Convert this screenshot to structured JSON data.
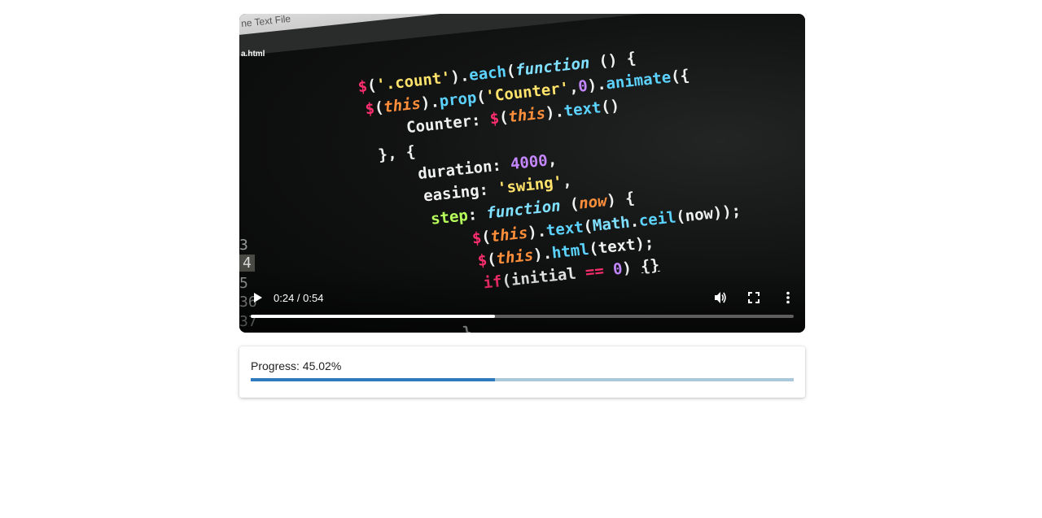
{
  "video": {
    "time_display": "0:24 / 0:54",
    "playback_fraction": 0.4502,
    "filename_tab": "a.html",
    "tab_text": "ne Text   File",
    "gutter_numbers": [
      "3",
      "4",
      "5",
      "36",
      "37"
    ],
    "code_lines": [
      "$('.count').each(function () {",
      "$(this).prop('Counter',0).animate({",
      "Counter: $(this).text()",
      "}, {",
      "duration: 4000,",
      "easing: 'swing',",
      "step: function (now) {",
      "$(this).text(Math.ceil(now));",
      "$(this).html(text);",
      "if(initial == 0) {}",
      "}",
      "});"
    ],
    "controls": {
      "play_icon": "play-icon",
      "volume_icon": "volume-icon",
      "fullscreen_icon": "fullscreen-icon",
      "more_icon": "more-vert-icon"
    }
  },
  "progress": {
    "label": "Progress: 45.02%",
    "percent": 45.02
  },
  "colors": {
    "progress_fill": "#2f7bbf",
    "progress_track": "#a9c8dc",
    "code_pink": "#ff2e6f",
    "code_yellow": "#ffe36b",
    "code_blue": "#5cd3ff",
    "code_orange": "#ff8f3a",
    "code_purple": "#c487ff",
    "code_green": "#b7ff5a"
  }
}
